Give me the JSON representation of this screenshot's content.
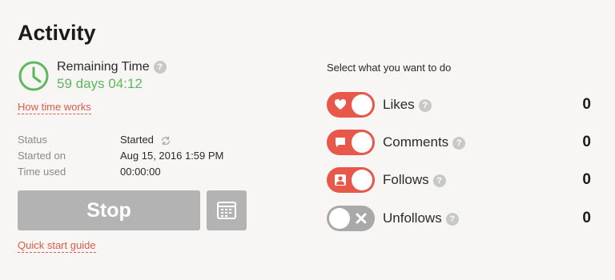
{
  "activity": {
    "title": "Activity",
    "remaining_time_label": "Remaining Time",
    "remaining_time_value": "59 days 04:12",
    "help_glyph": "?",
    "how_time_works": "How time works",
    "stats": [
      {
        "label": "Status",
        "value": "Started"
      },
      {
        "label": "Started on",
        "value": "Aug 15, 2016 1:59 PM"
      },
      {
        "label": "Time used",
        "value": "00:00:00"
      }
    ],
    "stop_label": "Stop",
    "quick_start_guide": "Quick start guide"
  },
  "actions": {
    "header": "Select what you want to do",
    "items": [
      {
        "label": "Likes",
        "count": "0",
        "enabled": true,
        "icon": "heart-icon"
      },
      {
        "label": "Comments",
        "count": "0",
        "enabled": true,
        "icon": "comment-icon"
      },
      {
        "label": "Follows",
        "count": "0",
        "enabled": true,
        "icon": "person-icon"
      },
      {
        "label": "Unfollows",
        "count": "0",
        "enabled": false,
        "icon": "x-icon"
      }
    ]
  },
  "colors": {
    "accent": "#e8584a",
    "success": "#5cb85c",
    "disabled": "#b3b3b3"
  }
}
